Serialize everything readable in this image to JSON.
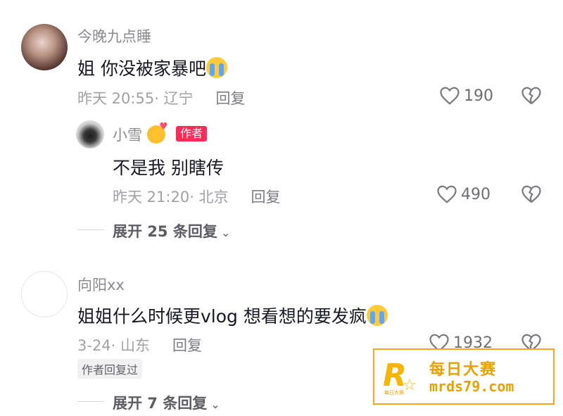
{
  "comments": [
    {
      "user": "今晚九点睡",
      "text": "姐 你没被家暴吧",
      "emoji": "crying-face",
      "time_location": "昨天 20:55· 辽宁",
      "reply_label": "回复",
      "likes": "190"
    },
    {
      "user": "小雪",
      "emoji_after_name": "smiling-face-with-hearts",
      "tag": "作者",
      "text": "不是我 别瞎传",
      "time_location": "昨天 21:20· 北京",
      "reply_label": "回复",
      "likes": "490"
    },
    {
      "user": "向阳xx",
      "text": "姐姐什么时候更vlog  想看想的要发疯",
      "emoji": "crying-face",
      "time_location": "3-24· 山东",
      "reply_label": "回复",
      "likes": "1932",
      "tag": "作者回复过"
    }
  ],
  "expand_1": "展开 25 条回复",
  "expand_2": "展开 7 条回复",
  "watermark": {
    "logo_letter": "R",
    "small_text": "每日大赛",
    "name": "每日大赛",
    "url": "mrds79.com"
  },
  "colors": {
    "accent": "#fe2c55",
    "watermark": "#f5a623"
  }
}
